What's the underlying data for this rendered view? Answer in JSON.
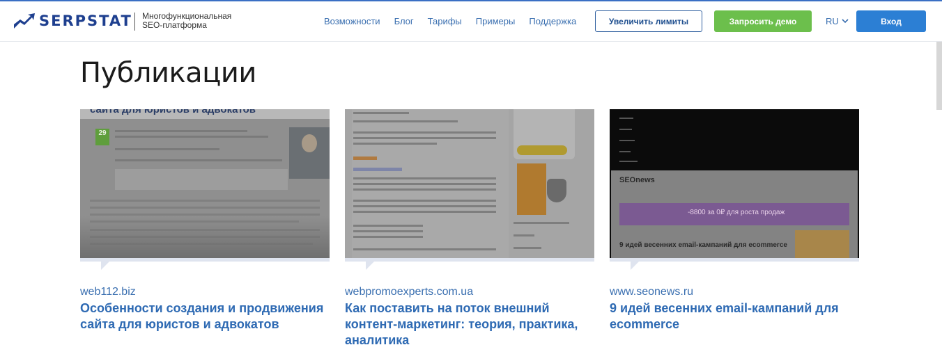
{
  "header": {
    "logo_text": "SERPSTAT",
    "tagline": "Многофункциональная SEO-платформа",
    "nav": [
      "Возможности",
      "Блог",
      "Тарифы",
      "Примеры",
      "Поддержка"
    ],
    "increase_limits": "Увеличить лимиты",
    "request_demo": "Запросить демо",
    "lang": "RU",
    "login": "Вход"
  },
  "page": {
    "title": "Публикации"
  },
  "cards": [
    {
      "source": "web112.biz",
      "title": "Особенности создания и продвижения сайта для юристов и адвокатов",
      "thumb_heading": "сайта для юристов и адвокатов",
      "thumb_date": "29"
    },
    {
      "source": "webpromoexperts.com.ua",
      "title": "Как поставить на поток внешний контент-маркетинг: теория, практика, аналитика"
    },
    {
      "source": "www.seonews.ru",
      "title": "9 идей весенних email-кампаний для ecommerce",
      "thumb_brand": "SEOnews",
      "thumb_banner": "-8800 за 0₽ для роста продаж",
      "thumb_footer": "9 идей весенних email-кампаний для ecommerce"
    }
  ],
  "colors": {
    "brand": "#1e3f8f",
    "link": "#2e6ab3",
    "green": "#6cbf4c",
    "blue": "#2c7fd4"
  }
}
